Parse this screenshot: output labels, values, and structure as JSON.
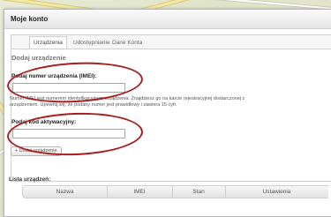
{
  "window": {
    "title": "Moje konto"
  },
  "tabs": [
    {
      "label": "Urządzenia"
    },
    {
      "label": "Udostępnianie"
    },
    {
      "label": "Dane Konta"
    }
  ],
  "add_device": {
    "section_title": "Dodaj urządzenie",
    "imei_label": "Podaj numer urządzenia (IMEI):",
    "imei_value": "",
    "imei_help_line1": "Numer IMEI jest numerem identyfikacyjnym urządzenia. Znajdziesz go na karcie rejestracyjnej dostarczonej z",
    "imei_help_line2": "urządzeniem. Upewnij się, że podany numer jest prawidłowy i zawiera 15 cyfr.",
    "code_label": "Podaj kod aktywacyjny:",
    "code_value": "",
    "add_button": "+ Dodaj urządzenie"
  },
  "device_list": {
    "title": "Lista urządzeń:",
    "columns": [
      "Nazwa",
      "IMEI",
      "Stan",
      "Ustawienia"
    ]
  },
  "colors": {
    "annotation": "#a81c1c"
  }
}
